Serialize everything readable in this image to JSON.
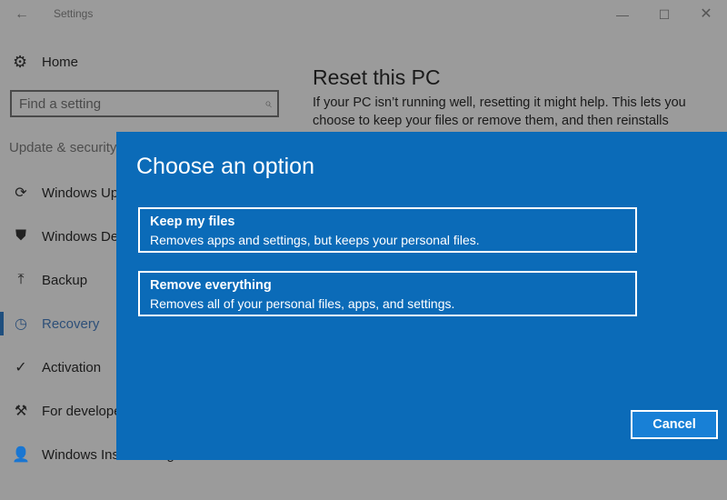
{
  "window": {
    "title": "Settings",
    "back_icon": "←",
    "minimize_icon": "—",
    "maximize_icon": "☐",
    "close_icon": "✕"
  },
  "sidebar": {
    "home_label": "Home",
    "home_icon": "⚙",
    "search": {
      "placeholder": "Find a setting",
      "value": "",
      "icon": "⌕"
    },
    "section_label": "Update & security",
    "items": [
      {
        "label": "Windows Update",
        "icon": "⟳"
      },
      {
        "label": "Windows Defender",
        "icon": "⛊"
      },
      {
        "label": "Backup",
        "icon": "⤒"
      },
      {
        "label": "Recovery",
        "icon": "◷",
        "selected": true
      },
      {
        "label": "Activation",
        "icon": "✓"
      },
      {
        "label": "For developers",
        "icon": "⚒"
      },
      {
        "label": "Windows Insider Program",
        "icon": "👤"
      }
    ],
    "accent_color": "#1f4f7e"
  },
  "main": {
    "title": "Reset this PC",
    "description": "If your PC isn’t running well, resetting it might help. This lets you choose to keep your files or remove them, and then reinstalls"
  },
  "dialog": {
    "title": "Choose an option",
    "background_color": "#0b6bb8",
    "options": [
      {
        "title": "Keep my files",
        "description": "Removes apps and settings, but keeps your personal files."
      },
      {
        "title": "Remove everything",
        "description": "Removes all of your personal files, apps, and settings."
      }
    ],
    "cancel_label": "Cancel"
  }
}
